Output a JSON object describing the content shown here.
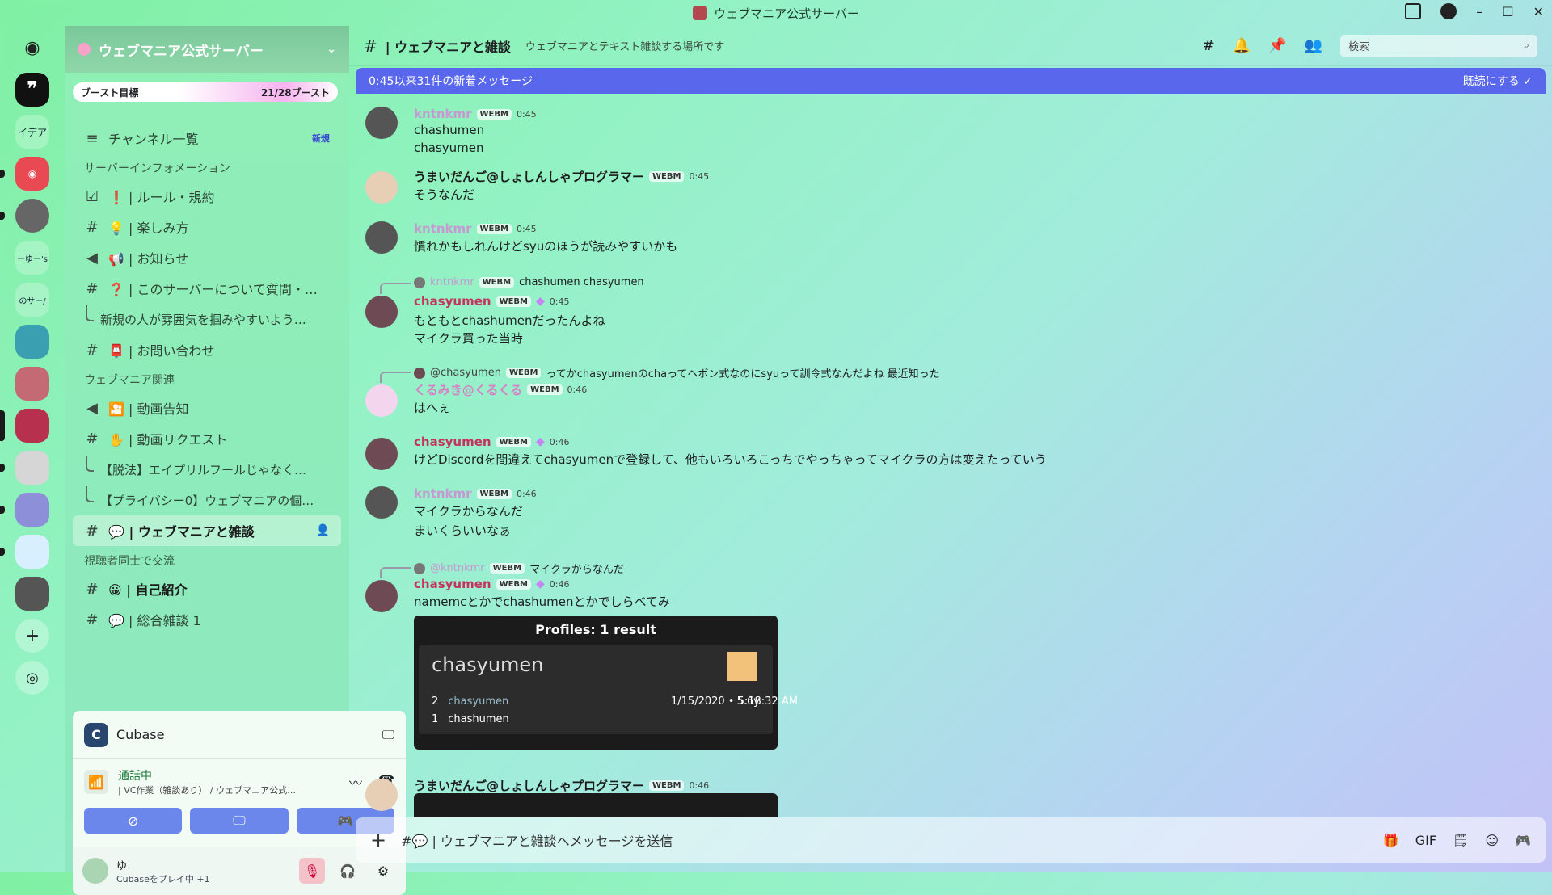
{
  "window": {
    "title": "ウェブマニア公式サーバー"
  },
  "rail": {
    "items": [
      "イデア",
      "ーゆー's",
      "のサー/"
    ]
  },
  "server": {
    "name": "ウェブマニア公式サーバー",
    "boost_label": "ブースト目標",
    "boost_count": "21/28ブースト"
  },
  "sidebar": {
    "channel_browser": "チャンネル一覧",
    "channel_browser_badge": "新規",
    "cat1": "サーバーインフォメーション",
    "ch_rules": "❗ | ルール・規約",
    "ch_fun": "💡 | 楽しみ方",
    "ch_news": "📢 | お知らせ",
    "ch_q": "❓ | このサーバーについて質問・…",
    "th_new": "新規の人が雰囲気を掴みやすいよう…",
    "ch_contact": "📮 | お問い合わせ",
    "cat2": "ウェブマニア関連",
    "ch_video": "🎦 | 動画告知",
    "ch_req": "✋ | 動画リクエスト",
    "th_a": "【脱法】エイプリルフールじゃなく…",
    "th_b": "【プライバシー0】ウェブマニアの個…",
    "ch_chat": "💬 | ウェブマニアと雑談",
    "cat3": "視聴者同士で交流",
    "ch_intro": "😀 | 自己紹介",
    "ch_general": "💬 | 総合雑談 1"
  },
  "panel": {
    "activity": "Cubase",
    "voice_status": "通話中",
    "voice_channel": "| VC作業（雑談あり） / ウェブマニア公式…",
    "user_name": "ゆ",
    "user_status": "Cubaseをプレイ中 +1"
  },
  "header": {
    "channel": "| ウェブマニアと雑談",
    "topic": "ウェブマニアとテキスト雑談する場所です",
    "search": "検索"
  },
  "newbar": {
    "text": "0:45以来31件の新着メッセージ",
    "mark_read": "既読にする"
  },
  "messages": [
    {
      "user": "kntnkmr",
      "tag": "WEBM",
      "time": "0:45",
      "lines": [
        "chashumen",
        "chasyumen"
      ]
    },
    {
      "user": "うまいだんご@しょしんしゃプログラマー",
      "tag": "WEBM",
      "time": "0:45",
      "lines": [
        "そうなんだ"
      ]
    },
    {
      "user": "kntnkmr",
      "tag": "WEBM",
      "time": "0:45",
      "lines": [
        "慣れかもしれんけどsyuのほうが読みやすいかも"
      ]
    },
    {
      "reply_user": "kntnkmr",
      "reply_tag": "WEBM",
      "reply_text": "chashumen chasyumen",
      "user": "chasyumen",
      "tag": "WEBM",
      "time": "0:45",
      "lines": [
        "もともとchashumenだったんよね",
        "マイクラ買った当時"
      ]
    },
    {
      "reply_user": "@chasyumen",
      "reply_tag": "WEBM",
      "reply_text": "ってかchasyumenのchaってヘボン式なのにsyuって訓令式なんだよね 最近知った",
      "user": "くるみき@くるくる",
      "tag": "WEBM",
      "time": "0:46",
      "lines": [
        "はへぇ"
      ]
    },
    {
      "user": "chasyumen",
      "tag": "WEBM",
      "time": "0:46",
      "lines": [
        "けどDiscordを間違えてchasyumenで登録して、他もいろいろこっちでやっちゃってマイクラの方は変えたっていう"
      ]
    },
    {
      "user": "kntnkmr",
      "tag": "WEBM",
      "time": "0:46",
      "lines": [
        "マイクラからなんだ",
        "まいくらいいなぁ"
      ]
    },
    {
      "reply_user": "@kntnkmr",
      "reply_tag": "WEBM",
      "reply_text": "マイクラからなんだ",
      "user": "chasyumen",
      "tag": "WEBM",
      "time": "0:46",
      "lines": [
        "namemcとかでchashumenとかでしらべてみ"
      ]
    },
    {
      "user": "うまいだんご@しょしんしゃプログラマー",
      "tag": "WEBM",
      "time": "0:46",
      "lines": []
    }
  ],
  "embed": {
    "title": "Profiles:  1 result",
    "name": "chasyumen",
    "row1_num": "2",
    "row1_name": "chasyumen",
    "row1_date": "1/15/2020 • 5:18:32 AM",
    "row1_age": "5.6y",
    "row2_num": "1",
    "row2_name": "chashumen"
  },
  "composer": {
    "placeholder": "#💬 | ウェブマニアと雑談へメッセージを送信",
    "gif": "GIF"
  }
}
